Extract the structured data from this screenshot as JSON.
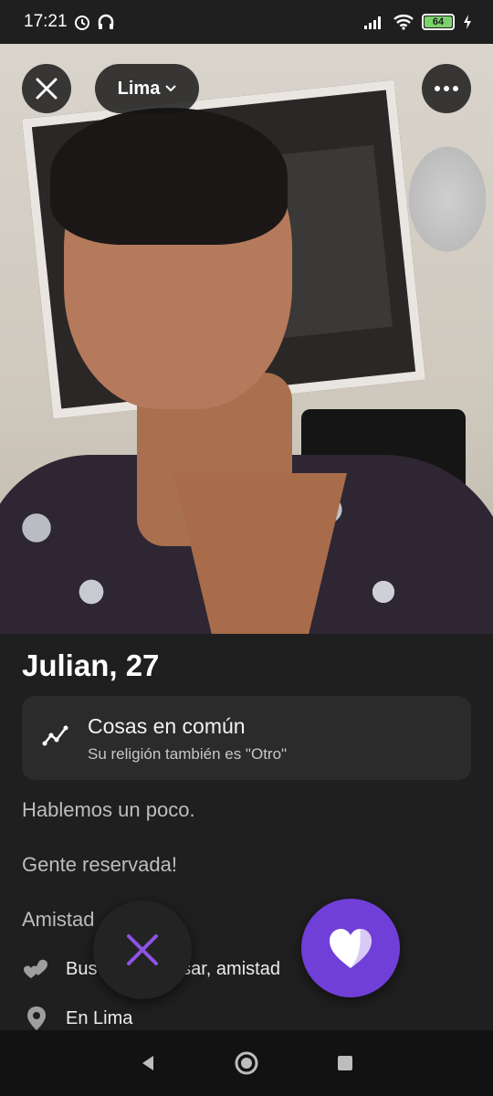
{
  "status_bar": {
    "time": "17:21",
    "battery": "64",
    "icons": [
      "alarm-icon",
      "headphones-icon",
      "signal-icon",
      "wifi-icon",
      "battery-icon",
      "charging-icon"
    ]
  },
  "header": {
    "city": "Lima",
    "icons": [
      "close-icon",
      "chevron-down-icon",
      "more-icon"
    ]
  },
  "profile": {
    "name_age": "Julian, 27",
    "common": {
      "title": "Cosas en común",
      "subtitle": "Su religión también es \"Otro\""
    },
    "bio_lines": [
      "Hablemos un poco.",
      "Gente reservada!",
      "Amistad"
    ],
    "looking_for": "Bus",
    "looking_for_tail": "rsar, amistad",
    "location": "En Lima"
  },
  "colors": {
    "accent": "#6f3fd8",
    "background": "#1f1f1f",
    "card": "#2b2b2b"
  },
  "actions": {
    "icons": [
      "x-icon",
      "heart-icon"
    ]
  },
  "nav": {
    "icons": [
      "back-icon",
      "home-icon",
      "recents-icon"
    ]
  }
}
